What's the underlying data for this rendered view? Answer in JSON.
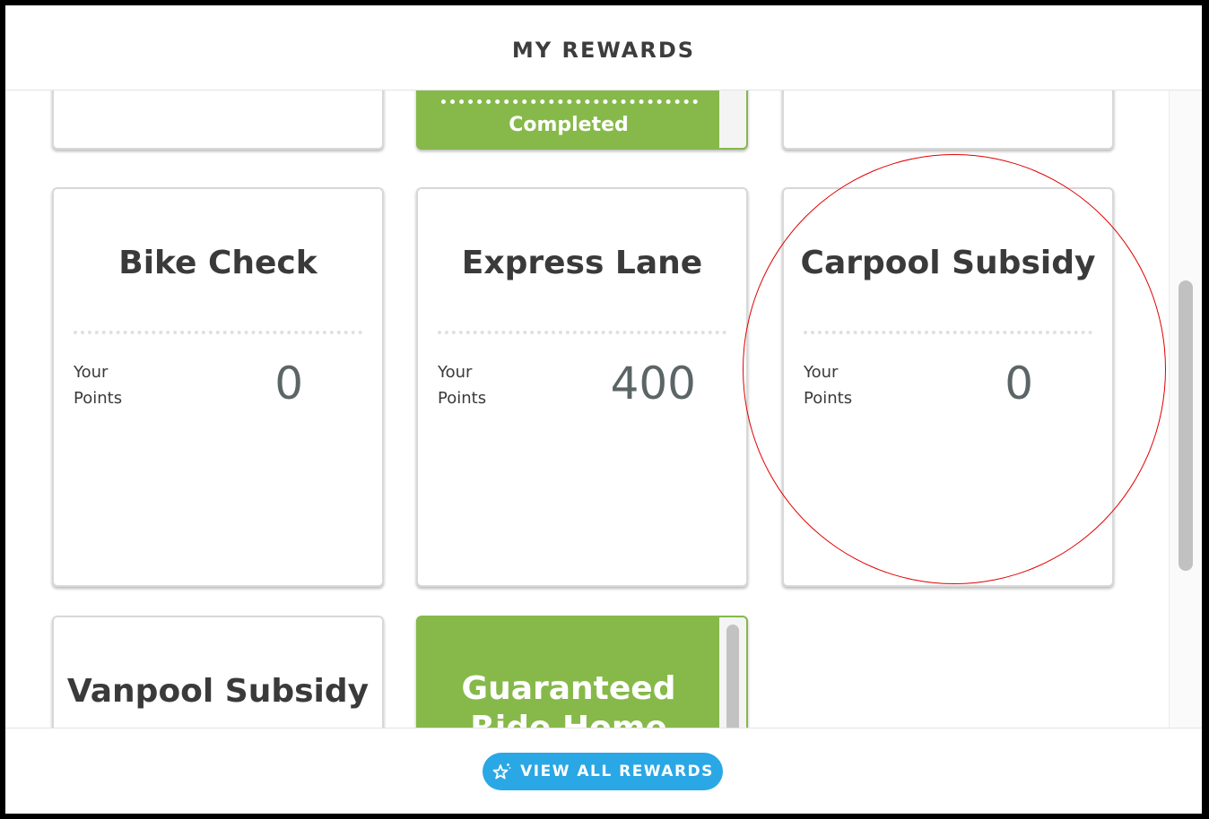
{
  "header": {
    "title": "MY REWARDS"
  },
  "top_row": {
    "middle_card": {
      "status": "Completed"
    }
  },
  "cards": [
    {
      "title": "Bike Check",
      "points_label_line1": "Your",
      "points_label_line2": "Points",
      "points": "0"
    },
    {
      "title": "Express Lane",
      "points_label_line1": "Your",
      "points_label_line2": "Points",
      "points": "400"
    },
    {
      "title": "Carpool Subsidy",
      "points_label_line1": "Your",
      "points_label_line2": "Points",
      "points": "0"
    }
  ],
  "bottom_row": [
    {
      "title": "Vanpool Subsidy"
    },
    {
      "title_line1": "Guaranteed",
      "title_line2": "Ride Home"
    }
  ],
  "footer": {
    "button_label": "VIEW ALL REWARDS",
    "button_icon": "sparkle-star-icon"
  },
  "colors": {
    "completed_green": "#86b94a",
    "button_blue": "#2aa7e5",
    "annotation_red": "#e10000"
  }
}
